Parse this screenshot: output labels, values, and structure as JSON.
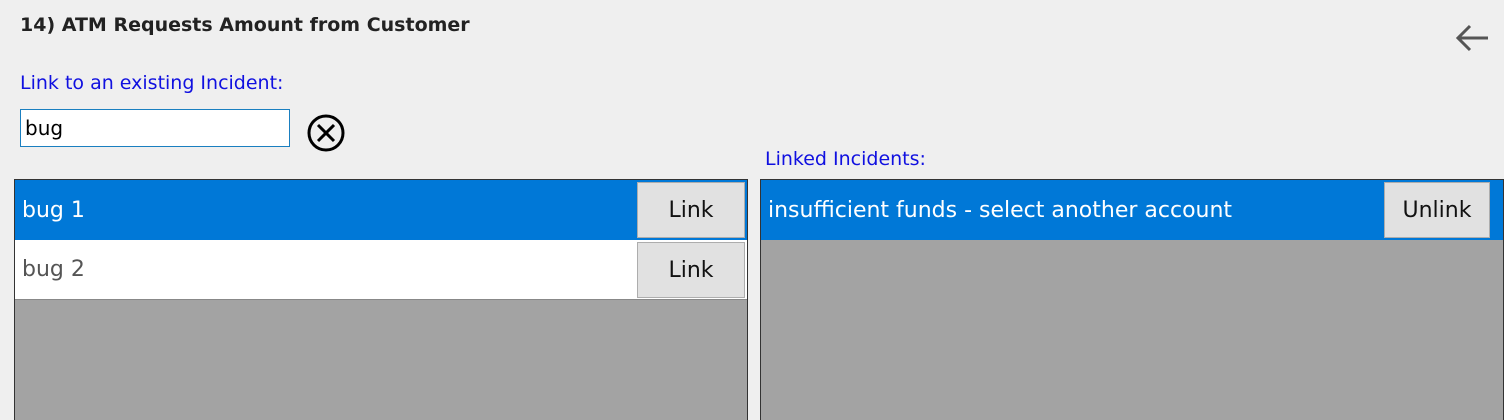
{
  "header": {
    "title": "14) ATM Requests Amount from Customer",
    "back_icon": "arrow-left-icon"
  },
  "search": {
    "label": "Link to an existing Incident:",
    "value": "bug",
    "clear_icon": "circle-x-icon"
  },
  "search_results": {
    "items": [
      {
        "label": "bug 1",
        "button": "Link",
        "selected": true
      },
      {
        "label": "bug 2",
        "button": "Link",
        "selected": false
      }
    ]
  },
  "linked": {
    "label": "Linked Incidents:",
    "items": [
      {
        "label": "insufficient funds - select another account",
        "button": "Unlink",
        "selected": true
      }
    ]
  },
  "colors": {
    "accent_blue": "#0078d7",
    "label_blue": "#1010e0",
    "panel_gray": "#a3a3a3",
    "background": "#efefef"
  }
}
